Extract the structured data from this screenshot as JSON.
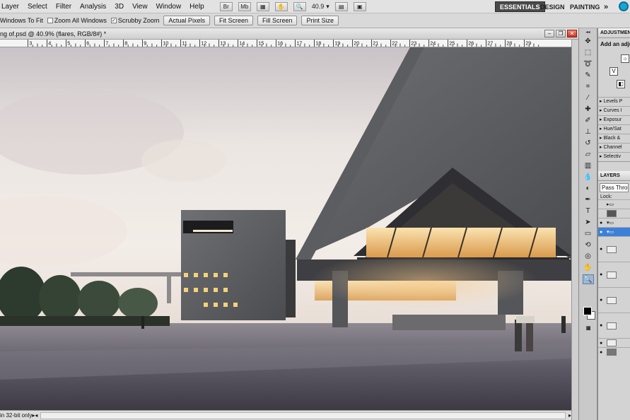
{
  "menu": [
    "Layer",
    "Select",
    "Filter",
    "Analysis",
    "3D",
    "View",
    "Window",
    "Help"
  ],
  "toolbar": {
    "zoom": "40.9",
    "mb": "Mb"
  },
  "workspaces": {
    "essentials": "ESSENTIALS",
    "design": "DESIGN",
    "painting": "PAINTING",
    "more": "»"
  },
  "options": {
    "resize_windows": "Windows To Fit",
    "zoom_all": "Zoom All Windows",
    "scrubby": "Scrubby Zoom",
    "actual_pixels": "Actual Pixels",
    "fit_screen": "Fit Screen",
    "fill_screen": "Fill Screen",
    "print_size": "Print Size"
  },
  "document": {
    "title": "ng of.psd @ 40.9% (flares, RGB/8#) *",
    "status": "in 32-bit only"
  },
  "ruler_ticks": [
    "3",
    "4",
    "5",
    "6",
    "7",
    "8",
    "9",
    "10",
    "11",
    "12",
    "13",
    "14",
    "15",
    "16",
    "17",
    "18",
    "19",
    "20",
    "21",
    "22",
    "23",
    "24",
    "25",
    "26",
    "27",
    "28",
    "29"
  ],
  "adjustments": {
    "tab": "ADJUSTMEN",
    "title": "Add an adju",
    "presets": [
      "Levels P",
      "Curves I",
      "Exposur",
      "Hue/Sat",
      "Black &",
      "Channel",
      "Selectiv"
    ]
  },
  "layers": {
    "tab": "LAYERS",
    "blend_mode": "Pass Throu",
    "lock_label": "Lock:"
  },
  "colors": {
    "accent": "#3d80d8",
    "active_ws": "#4a4a4a"
  }
}
